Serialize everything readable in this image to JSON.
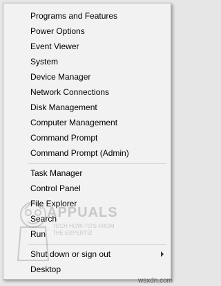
{
  "menu": {
    "group1": [
      {
        "label": "Programs and Features"
      },
      {
        "label": "Power Options"
      },
      {
        "label": "Event Viewer"
      },
      {
        "label": "System"
      },
      {
        "label": "Device Manager"
      },
      {
        "label": "Network Connections"
      },
      {
        "label": "Disk Management"
      },
      {
        "label": "Computer Management"
      },
      {
        "label": "Command Prompt"
      },
      {
        "label": "Command Prompt (Admin)"
      }
    ],
    "group2": [
      {
        "label": "Task Manager"
      },
      {
        "label": "Control Panel"
      },
      {
        "label": "File Explorer"
      },
      {
        "label": "Search"
      },
      {
        "label": "Run"
      }
    ],
    "group3": [
      {
        "label": "Shut down or sign out",
        "submenu": true
      },
      {
        "label": "Desktop"
      }
    ]
  },
  "watermark": {
    "brand": "APPUALS",
    "tagline": "TECH HOW-TO'S FROM THE EXPERTS!"
  },
  "site_label": "wsxdn.com",
  "colors": {
    "menu_bg": "#f2f2f2",
    "separator": "#cfcfcf",
    "text": "#000000"
  }
}
